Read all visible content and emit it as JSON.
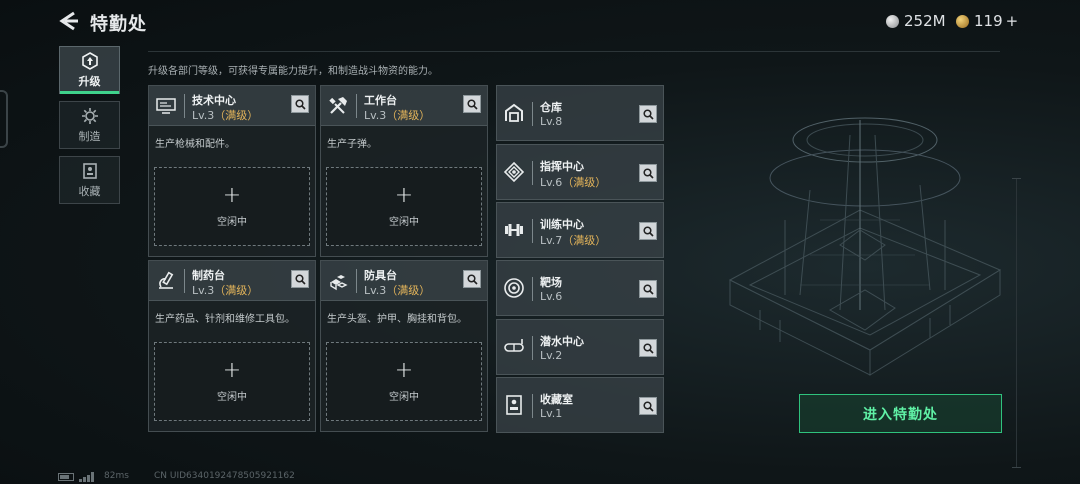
{
  "header": {
    "title": "特勤处",
    "currencies": [
      {
        "amount": "252M",
        "type": "silver"
      },
      {
        "amount": "119",
        "type": "gold",
        "suffix": "+"
      }
    ]
  },
  "side_tabs": [
    {
      "label": "升级",
      "icon": "upgrade-icon",
      "active": true
    },
    {
      "label": "制造",
      "icon": "gear-icon",
      "active": false
    },
    {
      "label": "收藏",
      "icon": "collection-icon",
      "active": false
    }
  ],
  "description": "升级各部门等级，可获得专属能力提升，和制造战斗物资的能力。",
  "workstations": [
    {
      "name": "技术中心",
      "level": "Lv.3",
      "max": "（满级）",
      "desc": "生产枪械和配件。",
      "icon": "tech-center-icon",
      "slot": {
        "plus": "+",
        "label": "空闲中"
      }
    },
    {
      "name": "工作台",
      "level": "Lv.3",
      "max": "（满级）",
      "desc": "生产子弹。",
      "icon": "workbench-icon",
      "slot": {
        "plus": "+",
        "label": "空闲中"
      }
    },
    {
      "name": "制药台",
      "level": "Lv.3",
      "max": "（满级）",
      "desc": "生产药品、针剂和维修工具包。",
      "icon": "pharmacy-icon",
      "slot": {
        "plus": "+",
        "label": "空闲中"
      }
    },
    {
      "name": "防具台",
      "level": "Lv.3",
      "max": "（满级）",
      "desc": "生产头盔、护甲、胸挂和背包。",
      "icon": "armor-bench-icon",
      "slot": {
        "plus": "+",
        "label": "空闲中"
      }
    }
  ],
  "facilities": [
    {
      "name": "仓库",
      "level": "Lv.8",
      "max": "",
      "icon": "warehouse-icon"
    },
    {
      "name": "指挥中心",
      "level": "Lv.6",
      "max": "（满级）",
      "icon": "command-center-icon"
    },
    {
      "name": "训练中心",
      "level": "Lv.7",
      "max": "（满级）",
      "icon": "dumbbell-icon"
    },
    {
      "name": "靶场",
      "level": "Lv.6",
      "max": "",
      "icon": "target-icon"
    },
    {
      "name": "潜水中心",
      "level": "Lv.2",
      "max": "",
      "icon": "diving-mask-icon"
    },
    {
      "name": "收藏室",
      "level": "Lv.1",
      "max": "",
      "icon": "collection-room-icon"
    }
  ],
  "enter_button": "进入特勤处",
  "footer": {
    "ping": "82ms",
    "uid": "CN UID6340192478505921162"
  },
  "colors": {
    "accent_green": "#3fd28c",
    "max_level_gold": "#e3b45a"
  }
}
